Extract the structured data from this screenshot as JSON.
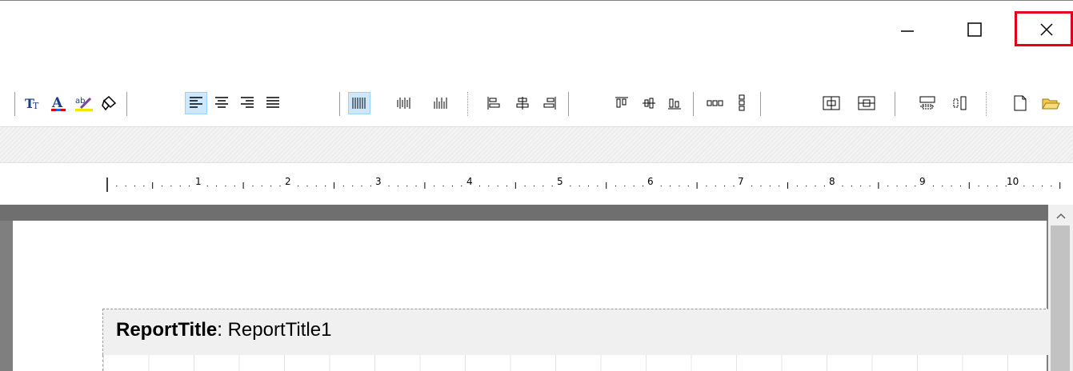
{
  "window": {
    "minimize_icon": "minimize-icon",
    "maximize_icon": "maximize-icon",
    "close_icon": "close-icon"
  },
  "toolbar": {
    "items": [
      {
        "name": "font-size-icon"
      },
      {
        "name": "font-color-icon"
      },
      {
        "name": "highlight-color-icon"
      },
      {
        "name": "clear-format-icon"
      },
      {
        "name": "align-left-icon",
        "active": true
      },
      {
        "name": "align-center-icon"
      },
      {
        "name": "align-right-icon"
      },
      {
        "name": "justify-icon"
      },
      {
        "name": "barcode-1-icon",
        "active": true
      },
      {
        "name": "barcode-2-icon"
      },
      {
        "name": "barcode-3-icon"
      },
      {
        "name": "align-lefts-icon"
      },
      {
        "name": "align-centers-icon"
      },
      {
        "name": "align-rights-icon"
      },
      {
        "name": "align-tops-icon"
      },
      {
        "name": "align-middles-icon"
      },
      {
        "name": "align-bottoms-icon"
      },
      {
        "name": "distribute-horizontal-icon"
      },
      {
        "name": "distribute-vertical-icon"
      },
      {
        "name": "center-horizontal-icon"
      },
      {
        "name": "center-vertical-icon"
      },
      {
        "name": "size-width-icon"
      },
      {
        "name": "size-height-icon"
      },
      {
        "name": "new-report-icon"
      },
      {
        "name": "open-folder-icon"
      }
    ]
  },
  "ruler": {
    "numbers": [
      "1",
      "2",
      "3",
      "4",
      "5",
      "6",
      "7",
      "8",
      "9",
      "10"
    ]
  },
  "report": {
    "band_kind": "ReportTitle",
    "band_separator": ":",
    "band_name": "ReportTitle1"
  },
  "colors": {
    "accent_close": "#e0001b",
    "active_button": "#cce8ff"
  }
}
